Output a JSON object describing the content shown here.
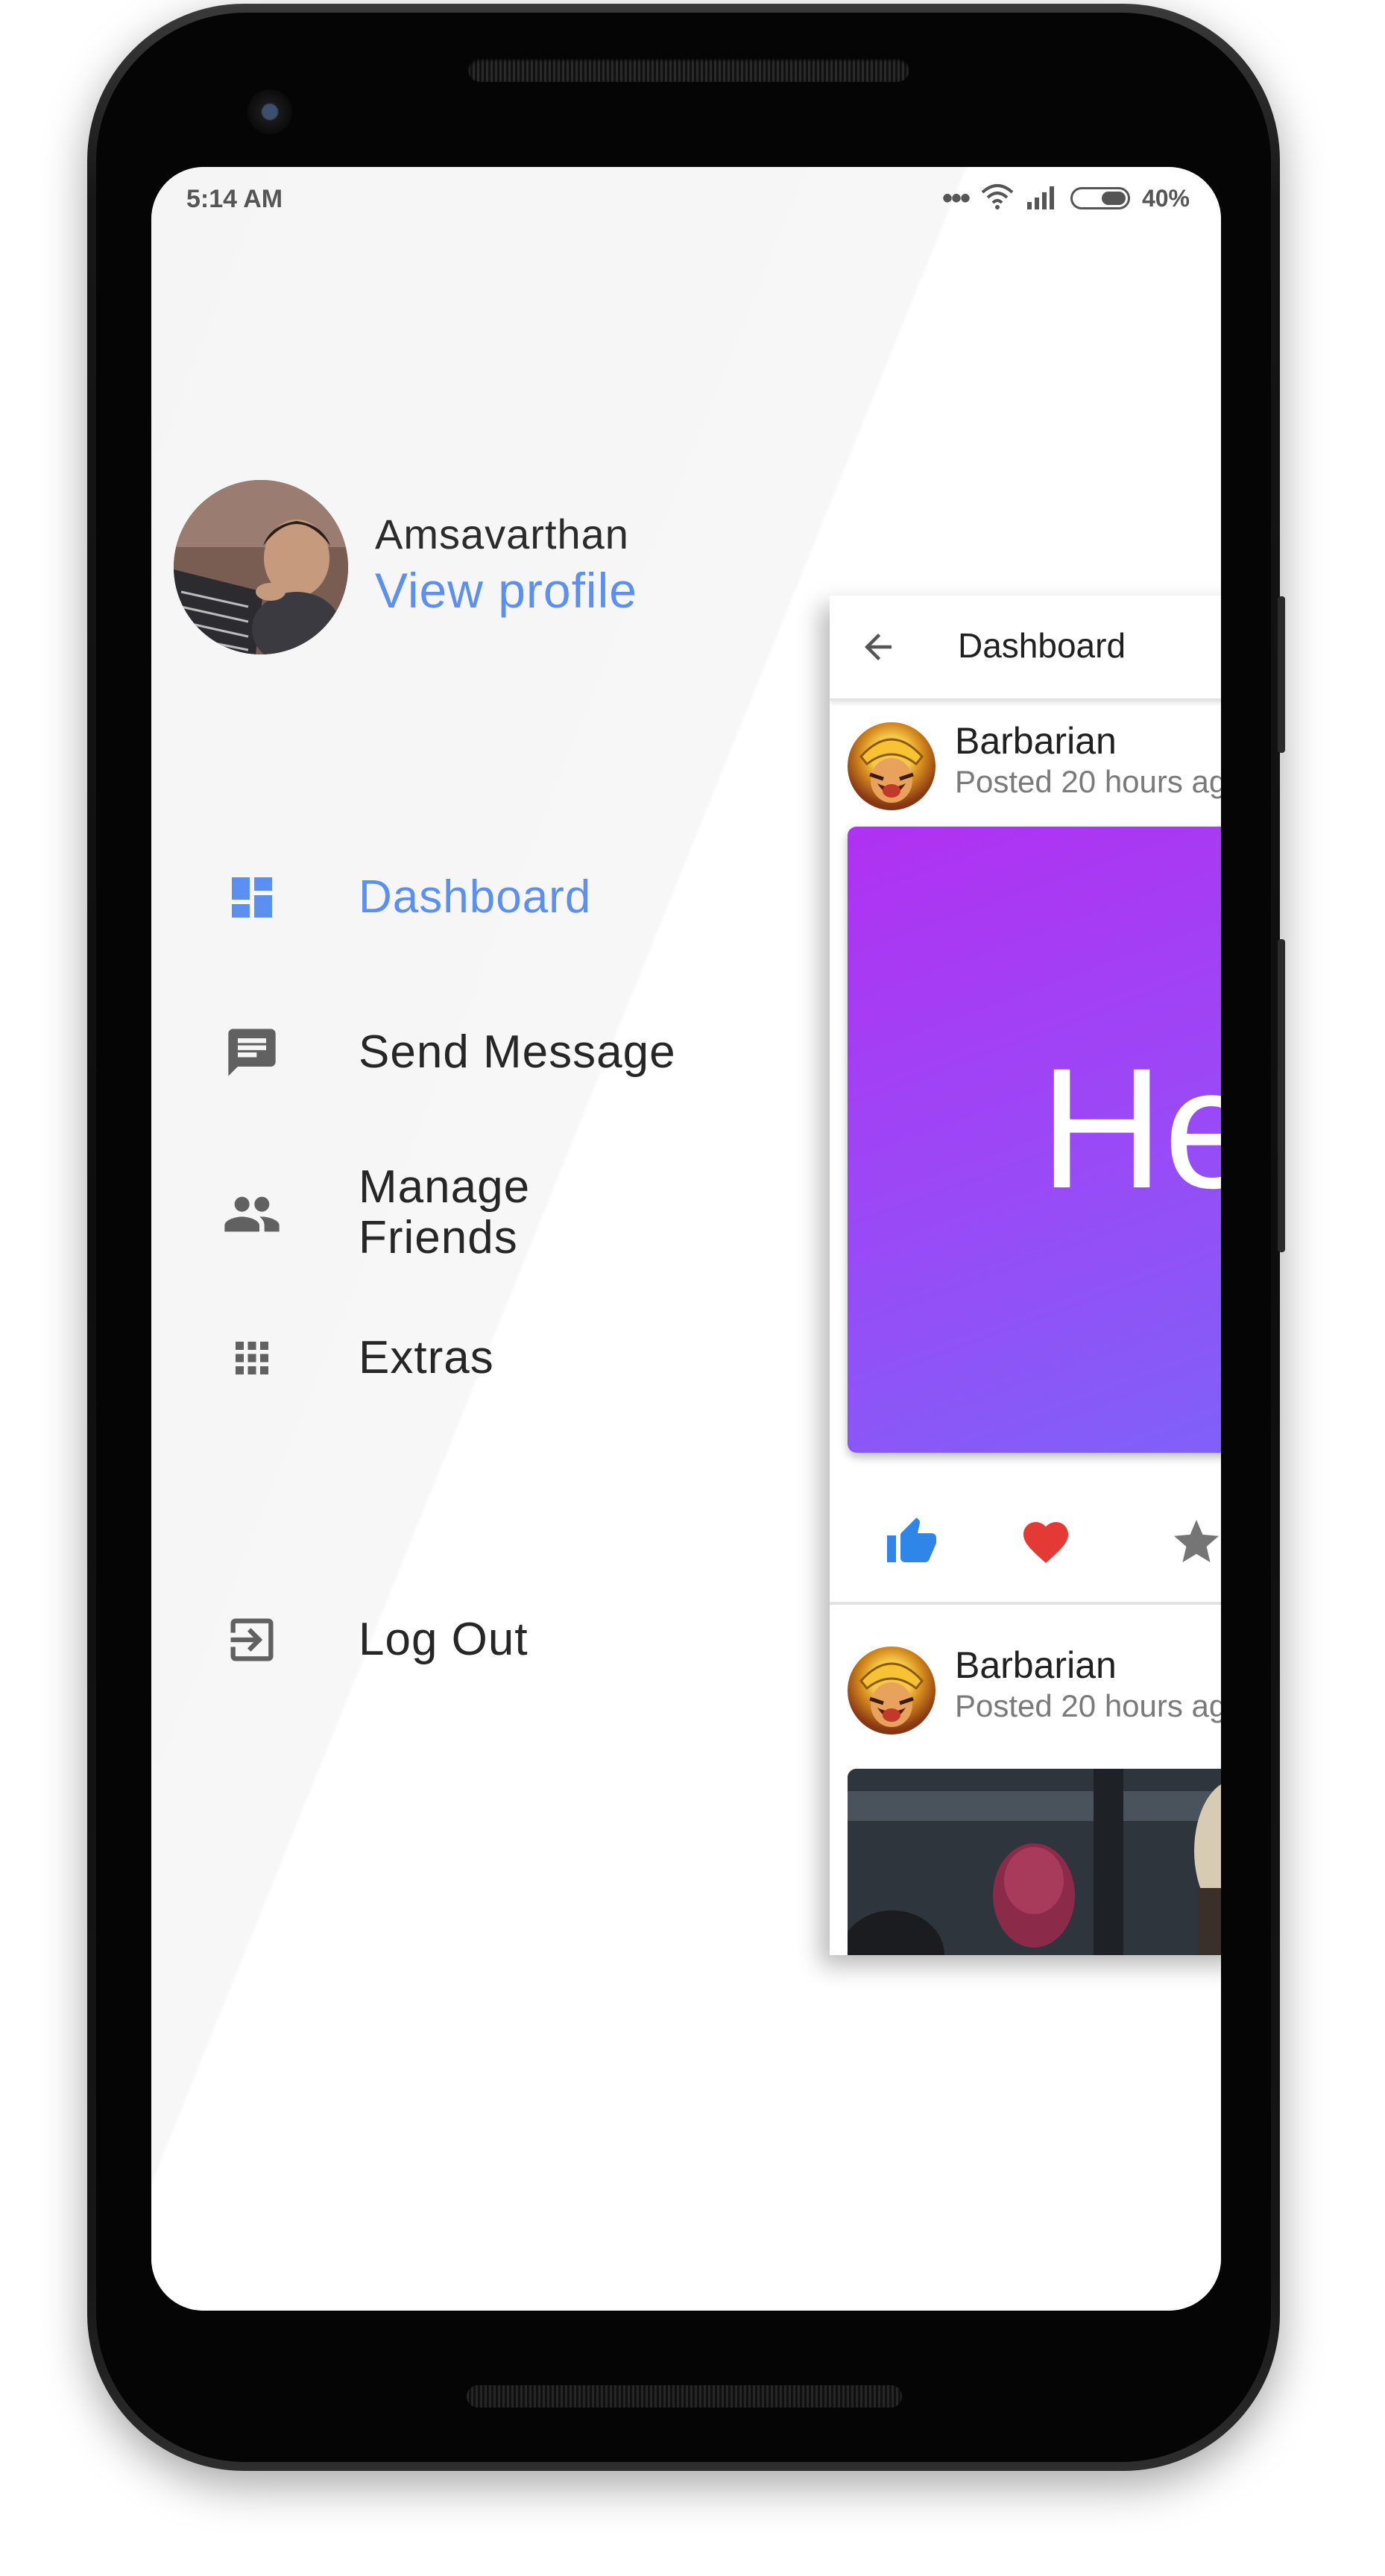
{
  "status_bar": {
    "time": "5:14 AM",
    "battery_percent": "40%",
    "icons": [
      "more-dots-icon",
      "wifi-icon",
      "signal-icon",
      "battery-icon"
    ]
  },
  "drawer": {
    "profile": {
      "name": "Amsavarthan",
      "link_label": "View profile"
    },
    "menu": [
      {
        "label": "Dashboard",
        "icon": "dashboard-icon",
        "active": true
      },
      {
        "label": "Send Message",
        "icon": "message-icon",
        "active": false
      },
      {
        "label": "Manage\nFriends",
        "icon": "people-icon",
        "active": false
      },
      {
        "label": "Extras",
        "icon": "apps-grid-icon",
        "active": false
      }
    ],
    "logout_label": "Log Out"
  },
  "preview": {
    "title": "Dashboard",
    "posts": [
      {
        "author": "Barbarian",
        "time": "Posted 20 hours ago",
        "content_text": "He"
      },
      {
        "author": "Barbarian",
        "time": "Posted 20 hours ago"
      }
    ],
    "actions": [
      "thumbs-up-icon",
      "heart-icon",
      "star-icon"
    ]
  },
  "colors": {
    "accent": "#5b8ff0",
    "card_gradient_start": "#b031f2",
    "card_gradient_end": "#7e62f8",
    "like": "#2f86e8",
    "heart": "#e53935",
    "star": "#757575"
  }
}
